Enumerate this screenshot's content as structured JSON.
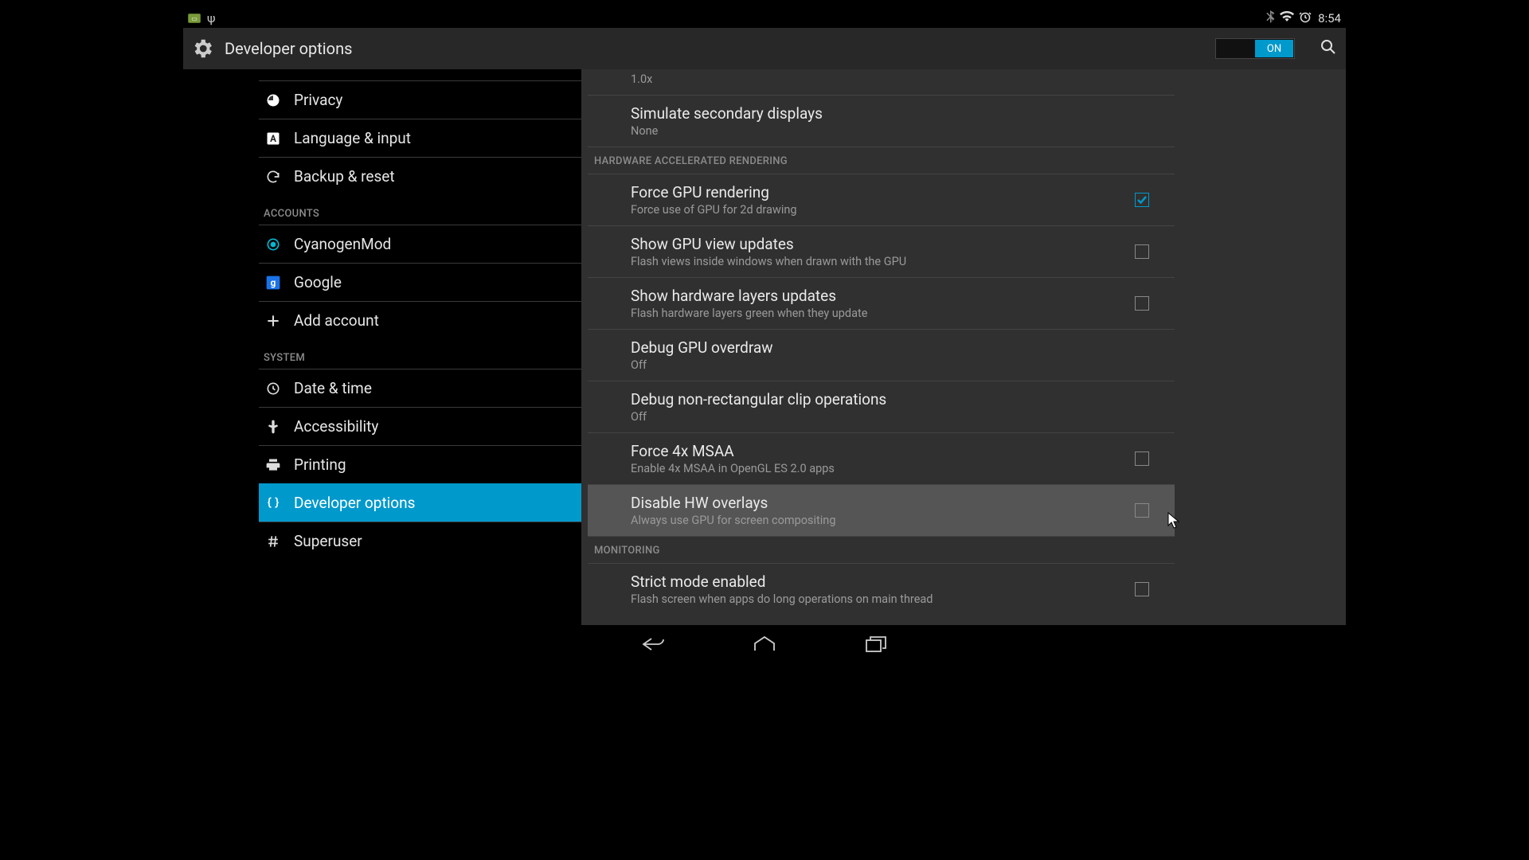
{
  "statusbar": {
    "time": "8:54"
  },
  "actionbar": {
    "title": "Developer options",
    "toggle_label": "ON"
  },
  "sidebar": {
    "items": [
      {
        "label": "Privacy",
        "icon": "privacy"
      },
      {
        "label": "Language & input",
        "icon": "language"
      },
      {
        "label": "Backup & reset",
        "icon": "backup"
      }
    ],
    "section_accounts": "Accounts",
    "accounts": [
      {
        "label": "CyanogenMod",
        "icon": "cyanogen"
      },
      {
        "label": "Google",
        "icon": "google"
      },
      {
        "label": "Add account",
        "icon": "add"
      }
    ],
    "section_system": "System",
    "system": [
      {
        "label": "Date & time",
        "icon": "clock"
      },
      {
        "label": "Accessibility",
        "icon": "hand"
      },
      {
        "label": "Printing",
        "icon": "print"
      },
      {
        "label": "Developer options",
        "icon": "braces",
        "selected": true
      },
      {
        "label": "Superuser",
        "icon": "hash"
      }
    ]
  },
  "detail": {
    "rows_top": [
      {
        "sub": "1.0x"
      },
      {
        "title": "Simulate secondary displays",
        "sub": "None"
      }
    ],
    "section_hw": "Hardware accelerated rendering",
    "rows_hw": [
      {
        "title": "Force GPU rendering",
        "sub": "Force use of GPU for 2d drawing",
        "checkbox": true,
        "checked": true
      },
      {
        "title": "Show GPU view updates",
        "sub": "Flash views inside windows when drawn with the GPU",
        "checkbox": true,
        "checked": false
      },
      {
        "title": "Show hardware layers updates",
        "sub": "Flash hardware layers green when they update",
        "checkbox": true,
        "checked": false
      },
      {
        "title": "Debug GPU overdraw",
        "sub": "Off"
      },
      {
        "title": "Debug non-rectangular clip operations",
        "sub": "Off"
      },
      {
        "title": "Force 4x MSAA",
        "sub": "Enable 4x MSAA in OpenGL ES 2.0 apps",
        "checkbox": true,
        "checked": false
      },
      {
        "title": "Disable HW overlays",
        "sub": "Always use GPU for screen compositing",
        "checkbox": true,
        "checked": false,
        "highlight": true
      }
    ],
    "section_mon": "Monitoring",
    "rows_mon": [
      {
        "title": "Strict mode enabled",
        "sub": "Flash screen when apps do long operations on main thread",
        "checkbox": true,
        "checked": false
      }
    ]
  }
}
